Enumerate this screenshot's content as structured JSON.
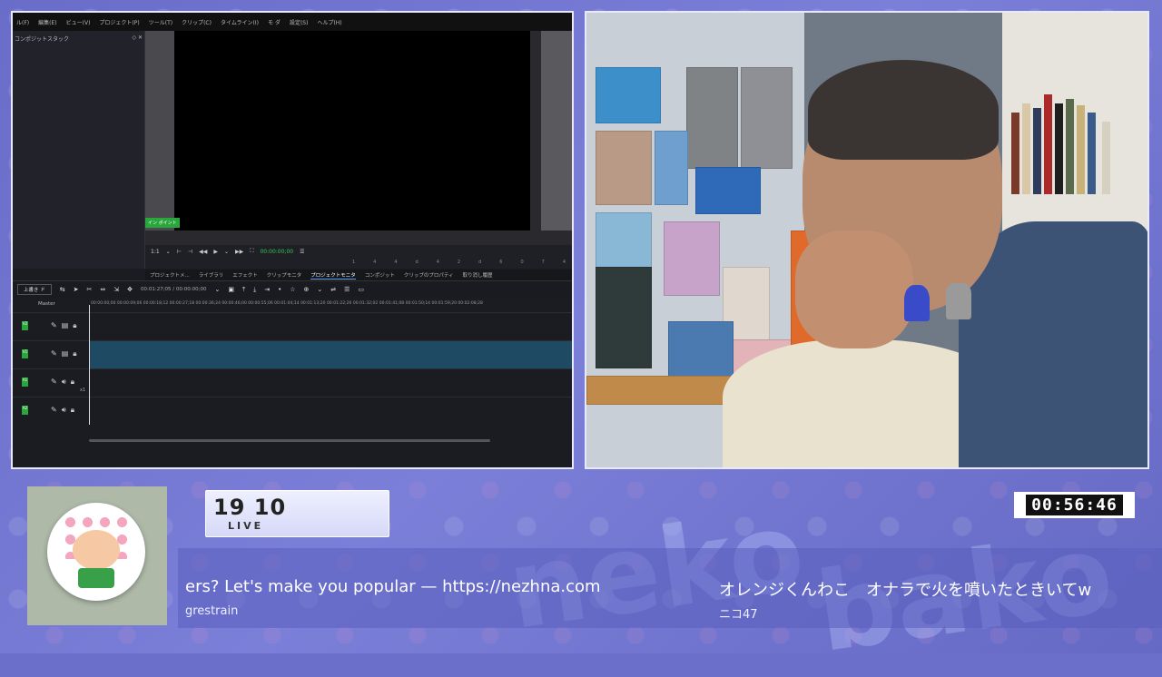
{
  "editor": {
    "menu": [
      "ル(F)",
      "編集(E)",
      "ビュー(V)",
      "プロジェクト(P)",
      "ツール(T)",
      "クリップ(C)",
      "タイムライン(I)",
      "モ ダ",
      "設定(S)",
      "ヘルプ(H)"
    ],
    "left_panel_title": "コンポジットスタック",
    "inpoint_label": "イン ポイント",
    "transport": {
      "zoom": "1:1",
      "timecode": "00:00:00;00",
      "ruler": [
        "14",
        "4d",
        "42",
        "d6",
        "0",
        "74"
      ]
    },
    "tabs": [
      "プロジェクトメ...",
      "ライブラリ",
      "エフェクト",
      "クリップモニタ",
      "プロジェクトモニタ",
      "コンポジット",
      "クリップのプロパティ",
      "取り消し履歴"
    ],
    "active_tab": "プロジェクトモニタ",
    "mode_select": "上書き ド",
    "timeline_tc": "00:01:27;05 / 00:00:00;00",
    "master_label": "Master",
    "ruler_ticks": "00:00:00;00   00:00:09;06   00:00:18;12   00:00:27;18   00:00:36;24   00:00:46;00   00:00:55;06   00:01:04;14   00:01:13;20   00:01:22;26   00:01:32;02   00:01:41;08   00:01:50;14   00:01:59;20   00:02:08;28",
    "tracks": [
      {
        "tag": "V2",
        "type": "video"
      },
      {
        "tag": "V1",
        "type": "video"
      },
      {
        "tag": "A1",
        "type": "audio",
        "sub": "x1"
      },
      {
        "tag": "A2",
        "type": "audio"
      }
    ]
  },
  "stream": {
    "viewers": "19 10",
    "live_label": "LIVE",
    "clock": "00:56:46",
    "ticker": [
      {
        "msg": "ers? Let's make you popular — https://nezhna.com",
        "author": "grestrain"
      },
      {
        "msg": "オレンジくんわこ　オナラで火を噴いたときいてw",
        "author": "ニコ47"
      }
    ]
  },
  "colors": {
    "background": "#6c6fc9",
    "panel_border": "#e8e8ff",
    "accent_green": "#2aa73c",
    "selected_track": "#1f4a63"
  }
}
